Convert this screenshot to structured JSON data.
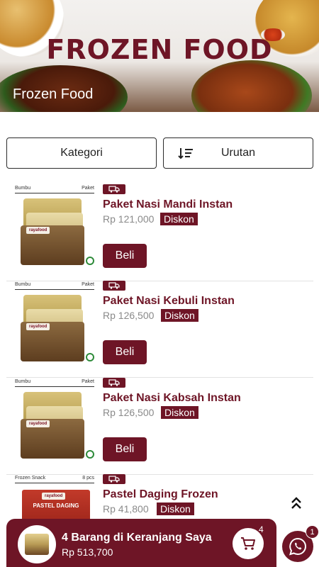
{
  "banner": {
    "title": "FROZEN FOOD",
    "subtitle": "Frozen Food"
  },
  "filters": {
    "kategori_label": "Kategori",
    "urutan_label": "Urutan"
  },
  "products": [
    {
      "name": "Paket Nasi Mandi Instan",
      "price": "Rp 121,000",
      "discount": "Diskon",
      "buy_label": "Beli",
      "thumb_left": "Bumbu",
      "thumb_right": "Paket",
      "brand": "rayafood"
    },
    {
      "name": "Paket Nasi Kebuli Instan",
      "price": "Rp 126,500",
      "discount": "Diskon",
      "buy_label": "Beli",
      "thumb_left": "Bumbu",
      "thumb_right": "Paket",
      "brand": "rayafood"
    },
    {
      "name": "Paket Nasi Kabsah Instan",
      "price": "Rp 126,500",
      "discount": "Diskon",
      "buy_label": "Beli",
      "thumb_left": "Bumbu",
      "thumb_right": "Paket",
      "brand": "rayafood"
    },
    {
      "name": "Pastel Daging Frozen",
      "price": "Rp 41,800",
      "discount": "Diskon",
      "thumb_left": "Frozen Snack",
      "thumb_right": "8 pcs",
      "brand": "rayafood",
      "pack_text": "PASTEL DAGING"
    }
  ],
  "cart": {
    "title": "4 Barang di Keranjang Saya",
    "total": "Rp 513,700",
    "count": "4"
  },
  "whatsapp": {
    "badge": "1"
  },
  "colors": {
    "brand": "#6e1526",
    "price_gray": "#8a8a8a",
    "whatsapp_icon": "#ffffff"
  },
  "icons": [
    "sort-icon",
    "truck-icon",
    "double-chevron-up-icon",
    "cart-icon",
    "whatsapp-icon"
  ]
}
